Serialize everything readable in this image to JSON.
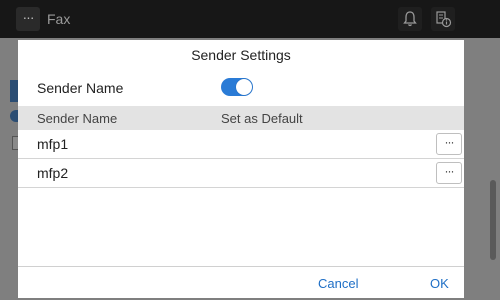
{
  "topbar": {
    "menu_icon": "more-horizontal-icon",
    "menu_glyph": "···",
    "title": "Fax",
    "notification_icon": "bell-icon",
    "info_icon": "device-info-icon"
  },
  "dialog": {
    "title": "Sender Settings",
    "toggle": {
      "label": "Sender Name",
      "enabled": true
    },
    "table": {
      "headers": {
        "name": "Sender Name",
        "default": "Set as Default"
      },
      "rows": [
        {
          "name": "mfp1",
          "more_glyph": "···"
        },
        {
          "name": "mfp2",
          "more_glyph": "···"
        }
      ]
    },
    "buttons": {
      "cancel": "Cancel",
      "ok": "OK"
    }
  },
  "colors": {
    "accent": "#2a7bd6",
    "link": "#1f6fc6",
    "header_bg": "#e3e3e3",
    "topbar_bg": "#171717"
  }
}
